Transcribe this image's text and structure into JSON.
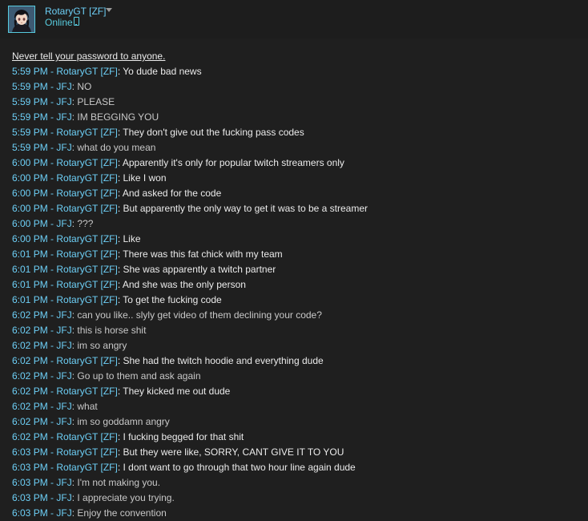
{
  "header": {
    "username": "RotaryGT [ZF]",
    "status": "Online",
    "status_icon": "mobile-phone-icon",
    "avatar_icon": "avatar-anime-character"
  },
  "warning": "Never tell your password to anyone.",
  "colors": {
    "background": "#1f1f1f",
    "meta_blue": "#6dcff6",
    "status_blue": "#57cbde",
    "text_light": "#ebebeb",
    "text_gray": "#c8c8c8"
  },
  "messages": [
    {
      "time": "5:59 PM",
      "sender": "RotaryGT [ZF]",
      "text": "Yo dude bad news"
    },
    {
      "time": "5:59 PM",
      "sender": "JFJ",
      "text": "NO"
    },
    {
      "time": "5:59 PM",
      "sender": "JFJ",
      "text": "PLEASE"
    },
    {
      "time": "5:59 PM",
      "sender": "JFJ",
      "text": "IM BEGGING YOU"
    },
    {
      "time": "5:59 PM",
      "sender": "RotaryGT [ZF]",
      "text": "They don't give out the fucking pass codes"
    },
    {
      "time": "5:59 PM",
      "sender": "JFJ",
      "text": "what do you mean"
    },
    {
      "time": "6:00 PM",
      "sender": "RotaryGT [ZF]",
      "text": "Apparently it's only for popular twitch streamers only"
    },
    {
      "time": "6:00 PM",
      "sender": "RotaryGT [ZF]",
      "text": "Like I won"
    },
    {
      "time": "6:00 PM",
      "sender": "RotaryGT [ZF]",
      "text": "And asked for the code"
    },
    {
      "time": "6:00 PM",
      "sender": "RotaryGT [ZF]",
      "text": "But apparently the only way to get it was to be a streamer"
    },
    {
      "time": "6:00 PM",
      "sender": "JFJ",
      "text": "???"
    },
    {
      "time": "6:00 PM",
      "sender": "RotaryGT [ZF]",
      "text": "Like"
    },
    {
      "time": "6:01 PM",
      "sender": "RotaryGT [ZF]",
      "text": "There was this fat chick with my team"
    },
    {
      "time": "6:01 PM",
      "sender": "RotaryGT [ZF]",
      "text": "She was apparently a twitch partner"
    },
    {
      "time": "6:01 PM",
      "sender": "RotaryGT [ZF]",
      "text": "And she was the only person"
    },
    {
      "time": "6:01 PM",
      "sender": "RotaryGT [ZF]",
      "text": "To get the fucking code"
    },
    {
      "time": "6:02 PM",
      "sender": "JFJ",
      "text": "can you like.. slyly get video of them declining your code?"
    },
    {
      "time": "6:02 PM",
      "sender": "JFJ",
      "text": "this is horse shit"
    },
    {
      "time": "6:02 PM",
      "sender": "JFJ",
      "text": "im so angry"
    },
    {
      "time": "6:02 PM",
      "sender": "RotaryGT [ZF]",
      "text": "She had the twitch hoodie and everything dude"
    },
    {
      "time": "6:02 PM",
      "sender": "JFJ",
      "text": "Go up to them and ask again"
    },
    {
      "time": "6:02 PM",
      "sender": "RotaryGT [ZF]",
      "text": "They kicked me out dude"
    },
    {
      "time": "6:02 PM",
      "sender": "JFJ",
      "text": "what"
    },
    {
      "time": "6:02 PM",
      "sender": "JFJ",
      "text": "im so goddamn angry"
    },
    {
      "time": "6:02 PM",
      "sender": "RotaryGT [ZF]",
      "text": "I fucking begged for that shit"
    },
    {
      "time": "6:03 PM",
      "sender": "RotaryGT [ZF]",
      "text": "But they were like, SORRY, CANT GIVE IT TO YOU"
    },
    {
      "time": "6:03 PM",
      "sender": "RotaryGT [ZF]",
      "text": "I dont want to go through that two hour line again dude"
    },
    {
      "time": "6:03 PM",
      "sender": "JFJ",
      "text": "I'm not making you."
    },
    {
      "time": "6:03 PM",
      "sender": "JFJ",
      "text": "I appreciate you trying."
    },
    {
      "time": "6:03 PM",
      "sender": "JFJ",
      "text": "Enjoy the convention"
    }
  ]
}
